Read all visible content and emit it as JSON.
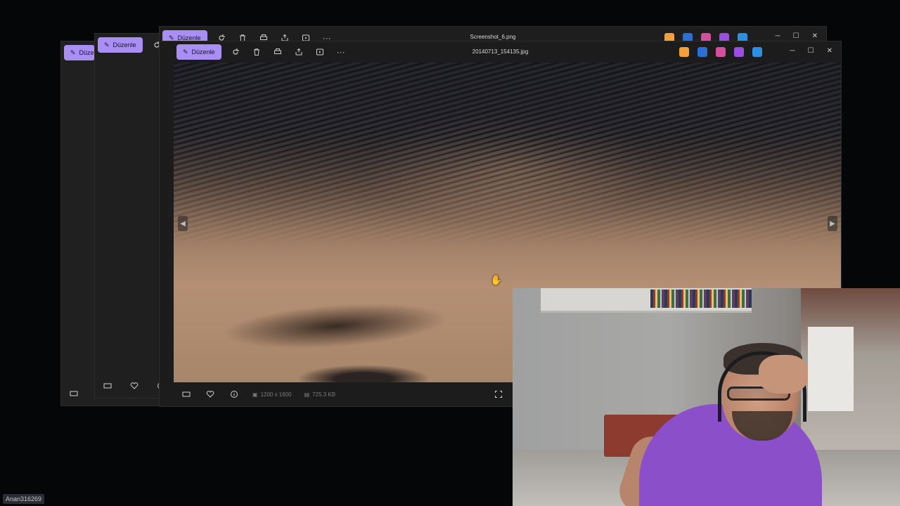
{
  "windows": {
    "back2": {
      "edit_label": "Düzenle"
    },
    "back1": {
      "edit_label": "Düzenle"
    },
    "mid": {
      "edit_label": "Düzenle",
      "title": "Screenshot_6.png"
    },
    "front": {
      "edit_label": "Düzenle",
      "title": "20140713_154135.jpg",
      "dimensions": "1200 x 1600",
      "file_size": "725.3 KB"
    }
  },
  "toolbar_icons": [
    "edit-icon",
    "rotate-icon",
    "delete-icon",
    "print-icon",
    "share-icon",
    "slideshow-icon",
    "more-icon"
  ],
  "app_icons": [
    {
      "name": "copilot-icon",
      "color": "#f2a03b"
    },
    {
      "name": "blue-app-icon",
      "color": "#2b6fd6"
    },
    {
      "name": "pink-app-icon",
      "color": "#d64f9e"
    },
    {
      "name": "purple-app-icon",
      "color": "#9b4fe0"
    },
    {
      "name": "cloud-app-icon",
      "color": "#2d8fe0"
    }
  ],
  "overlay": {
    "username": "Anan316269"
  }
}
